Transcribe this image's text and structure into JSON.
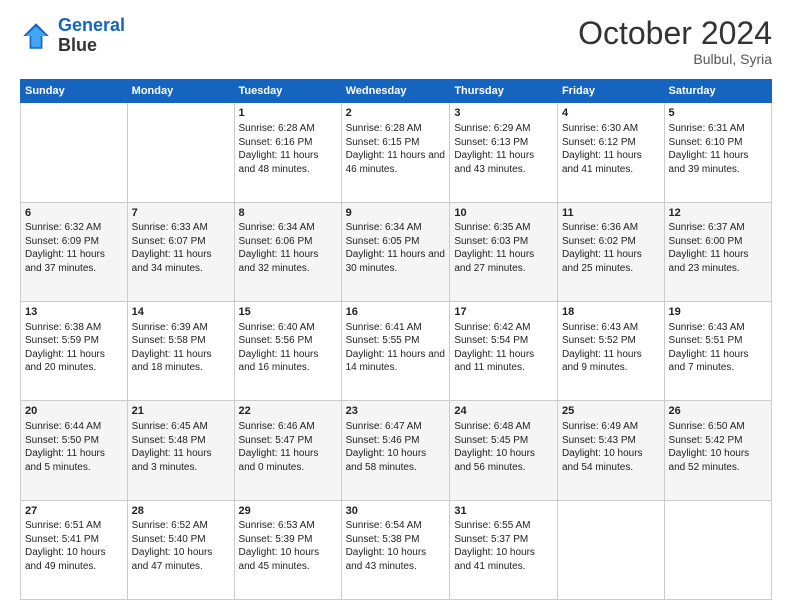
{
  "header": {
    "logo_line1": "General",
    "logo_line2": "Blue",
    "month_title": "October 2024",
    "subtitle": "Bulbul, Syria"
  },
  "days_of_week": [
    "Sunday",
    "Monday",
    "Tuesday",
    "Wednesday",
    "Thursday",
    "Friday",
    "Saturday"
  ],
  "weeks": [
    [
      {
        "day": "",
        "sunrise": "",
        "sunset": "",
        "daylight": ""
      },
      {
        "day": "",
        "sunrise": "",
        "sunset": "",
        "daylight": ""
      },
      {
        "day": "1",
        "sunrise": "Sunrise: 6:28 AM",
        "sunset": "Sunset: 6:16 PM",
        "daylight": "Daylight: 11 hours and 48 minutes."
      },
      {
        "day": "2",
        "sunrise": "Sunrise: 6:28 AM",
        "sunset": "Sunset: 6:15 PM",
        "daylight": "Daylight: 11 hours and 46 minutes."
      },
      {
        "day": "3",
        "sunrise": "Sunrise: 6:29 AM",
        "sunset": "Sunset: 6:13 PM",
        "daylight": "Daylight: 11 hours and 43 minutes."
      },
      {
        "day": "4",
        "sunrise": "Sunrise: 6:30 AM",
        "sunset": "Sunset: 6:12 PM",
        "daylight": "Daylight: 11 hours and 41 minutes."
      },
      {
        "day": "5",
        "sunrise": "Sunrise: 6:31 AM",
        "sunset": "Sunset: 6:10 PM",
        "daylight": "Daylight: 11 hours and 39 minutes."
      }
    ],
    [
      {
        "day": "6",
        "sunrise": "Sunrise: 6:32 AM",
        "sunset": "Sunset: 6:09 PM",
        "daylight": "Daylight: 11 hours and 37 minutes."
      },
      {
        "day": "7",
        "sunrise": "Sunrise: 6:33 AM",
        "sunset": "Sunset: 6:07 PM",
        "daylight": "Daylight: 11 hours and 34 minutes."
      },
      {
        "day": "8",
        "sunrise": "Sunrise: 6:34 AM",
        "sunset": "Sunset: 6:06 PM",
        "daylight": "Daylight: 11 hours and 32 minutes."
      },
      {
        "day": "9",
        "sunrise": "Sunrise: 6:34 AM",
        "sunset": "Sunset: 6:05 PM",
        "daylight": "Daylight: 11 hours and 30 minutes."
      },
      {
        "day": "10",
        "sunrise": "Sunrise: 6:35 AM",
        "sunset": "Sunset: 6:03 PM",
        "daylight": "Daylight: 11 hours and 27 minutes."
      },
      {
        "day": "11",
        "sunrise": "Sunrise: 6:36 AM",
        "sunset": "Sunset: 6:02 PM",
        "daylight": "Daylight: 11 hours and 25 minutes."
      },
      {
        "day": "12",
        "sunrise": "Sunrise: 6:37 AM",
        "sunset": "Sunset: 6:00 PM",
        "daylight": "Daylight: 11 hours and 23 minutes."
      }
    ],
    [
      {
        "day": "13",
        "sunrise": "Sunrise: 6:38 AM",
        "sunset": "Sunset: 5:59 PM",
        "daylight": "Daylight: 11 hours and 20 minutes."
      },
      {
        "day": "14",
        "sunrise": "Sunrise: 6:39 AM",
        "sunset": "Sunset: 5:58 PM",
        "daylight": "Daylight: 11 hours and 18 minutes."
      },
      {
        "day": "15",
        "sunrise": "Sunrise: 6:40 AM",
        "sunset": "Sunset: 5:56 PM",
        "daylight": "Daylight: 11 hours and 16 minutes."
      },
      {
        "day": "16",
        "sunrise": "Sunrise: 6:41 AM",
        "sunset": "Sunset: 5:55 PM",
        "daylight": "Daylight: 11 hours and 14 minutes."
      },
      {
        "day": "17",
        "sunrise": "Sunrise: 6:42 AM",
        "sunset": "Sunset: 5:54 PM",
        "daylight": "Daylight: 11 hours and 11 minutes."
      },
      {
        "day": "18",
        "sunrise": "Sunrise: 6:43 AM",
        "sunset": "Sunset: 5:52 PM",
        "daylight": "Daylight: 11 hours and 9 minutes."
      },
      {
        "day": "19",
        "sunrise": "Sunrise: 6:43 AM",
        "sunset": "Sunset: 5:51 PM",
        "daylight": "Daylight: 11 hours and 7 minutes."
      }
    ],
    [
      {
        "day": "20",
        "sunrise": "Sunrise: 6:44 AM",
        "sunset": "Sunset: 5:50 PM",
        "daylight": "Daylight: 11 hours and 5 minutes."
      },
      {
        "day": "21",
        "sunrise": "Sunrise: 6:45 AM",
        "sunset": "Sunset: 5:48 PM",
        "daylight": "Daylight: 11 hours and 3 minutes."
      },
      {
        "day": "22",
        "sunrise": "Sunrise: 6:46 AM",
        "sunset": "Sunset: 5:47 PM",
        "daylight": "Daylight: 11 hours and 0 minutes."
      },
      {
        "day": "23",
        "sunrise": "Sunrise: 6:47 AM",
        "sunset": "Sunset: 5:46 PM",
        "daylight": "Daylight: 10 hours and 58 minutes."
      },
      {
        "day": "24",
        "sunrise": "Sunrise: 6:48 AM",
        "sunset": "Sunset: 5:45 PM",
        "daylight": "Daylight: 10 hours and 56 minutes."
      },
      {
        "day": "25",
        "sunrise": "Sunrise: 6:49 AM",
        "sunset": "Sunset: 5:43 PM",
        "daylight": "Daylight: 10 hours and 54 minutes."
      },
      {
        "day": "26",
        "sunrise": "Sunrise: 6:50 AM",
        "sunset": "Sunset: 5:42 PM",
        "daylight": "Daylight: 10 hours and 52 minutes."
      }
    ],
    [
      {
        "day": "27",
        "sunrise": "Sunrise: 6:51 AM",
        "sunset": "Sunset: 5:41 PM",
        "daylight": "Daylight: 10 hours and 49 minutes."
      },
      {
        "day": "28",
        "sunrise": "Sunrise: 6:52 AM",
        "sunset": "Sunset: 5:40 PM",
        "daylight": "Daylight: 10 hours and 47 minutes."
      },
      {
        "day": "29",
        "sunrise": "Sunrise: 6:53 AM",
        "sunset": "Sunset: 5:39 PM",
        "daylight": "Daylight: 10 hours and 45 minutes."
      },
      {
        "day": "30",
        "sunrise": "Sunrise: 6:54 AM",
        "sunset": "Sunset: 5:38 PM",
        "daylight": "Daylight: 10 hours and 43 minutes."
      },
      {
        "day": "31",
        "sunrise": "Sunrise: 6:55 AM",
        "sunset": "Sunset: 5:37 PM",
        "daylight": "Daylight: 10 hours and 41 minutes."
      },
      {
        "day": "",
        "sunrise": "",
        "sunset": "",
        "daylight": ""
      },
      {
        "day": "",
        "sunrise": "",
        "sunset": "",
        "daylight": ""
      }
    ]
  ]
}
